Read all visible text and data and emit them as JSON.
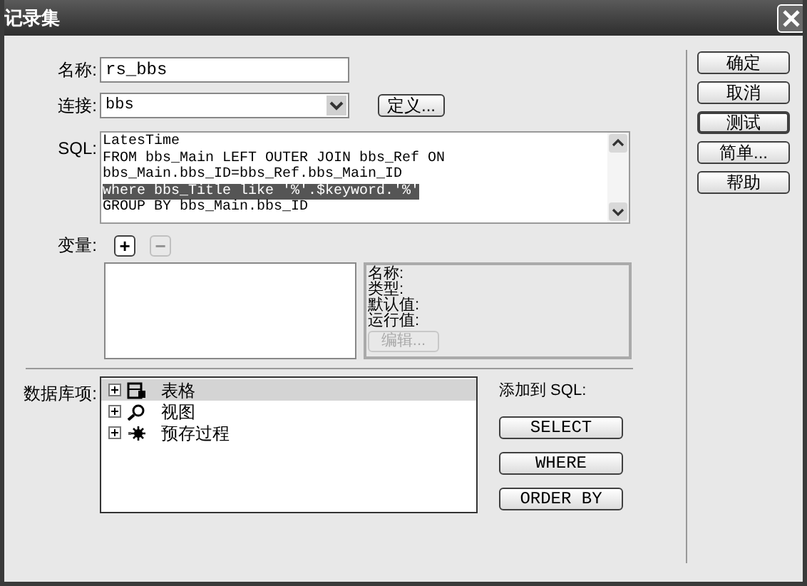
{
  "window": {
    "title": "记录集"
  },
  "name_field": {
    "label": "名称:",
    "value": "rs_bbs"
  },
  "connection": {
    "label": "连接:",
    "value": "bbs",
    "define_button": "定义..."
  },
  "sql": {
    "label": "SQL:",
    "lines": [
      {
        "text": "LatesTime",
        "selected": false
      },
      {
        "text": "FROM bbs_Main LEFT OUTER JOIN bbs_Ref ON",
        "selected": false
      },
      {
        "text": "bbs_Main.bbs_ID=bbs_Ref.bbs_Main_ID",
        "selected": false
      },
      {
        "text": "where bbs_Title like '%'.$keyword.'%'",
        "selected": true
      },
      {
        "text": "GROUP BY bbs_Main.bbs_ID",
        "selected": false
      }
    ]
  },
  "variables": {
    "label": "变量:",
    "add": {
      "text": "+",
      "disabled": false
    },
    "remove": {
      "text": "−",
      "disabled": true
    },
    "details": [
      "名称:",
      "类型:",
      "默认值:",
      "运行值:"
    ],
    "edit_button": {
      "text": "编辑...",
      "disabled": true
    }
  },
  "database_items": {
    "label": "数据库项:",
    "items": [
      {
        "text": "表格",
        "kind": "table",
        "selected": true
      },
      {
        "text": "视图",
        "kind": "view",
        "selected": false
      },
      {
        "text": "预存过程",
        "kind": "procedure",
        "selected": false
      }
    ]
  },
  "add_to_sql": {
    "label": "添加到 SQL:",
    "buttons": [
      "SELECT",
      "WHERE",
      "ORDER BY"
    ]
  },
  "dialog_buttons": [
    {
      "text": "确定",
      "focused": false
    },
    {
      "text": "取消",
      "focused": false
    },
    {
      "text": "测试",
      "focused": true
    },
    {
      "text": "简单...",
      "focused": false
    },
    {
      "text": "帮助",
      "focused": false
    }
  ]
}
